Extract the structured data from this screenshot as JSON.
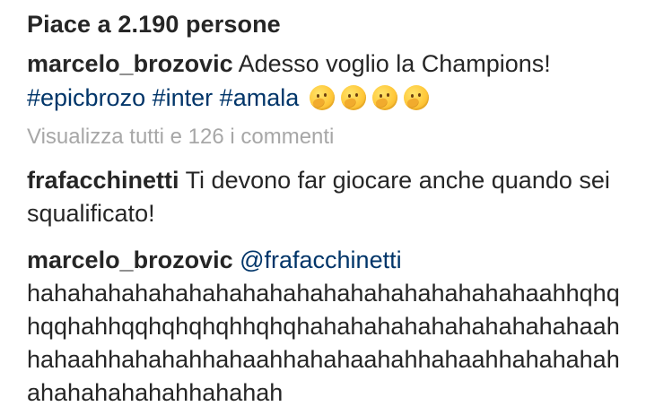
{
  "post": {
    "likes_text": "Piace a 2.190 persone",
    "caption_username": "marcelo_brozovic",
    "caption_text": "Adesso voglio la Champions!",
    "hashtags": [
      "#epicbrozo",
      "#inter",
      "#amala"
    ],
    "emojis": [
      "thinking-face-icon",
      "thinking-face-icon",
      "thinking-face-icon",
      "thinking-face-icon"
    ],
    "view_all_comments": "Visualizza tutti e 126 i commenti"
  },
  "comments": [
    {
      "username": "frafacchinetti",
      "text": "Ti devono far giocare anche quando sei squalificato!"
    },
    {
      "username": "marcelo_brozovic",
      "mention": "@frafacchinetti",
      "text": "hahahahahahahahahahahahahahahahahahahaahhqhqhqqhahhqqhqhqhqhhqhqhahahahahahahahahahahaahhahaahhahahahhahaahhahahaahahhahaahhahahahahahahahahahahhahahah"
    }
  ],
  "colors": {
    "text_primary": "#262626",
    "hashtag": "#003569",
    "muted": "#a7a7a7",
    "background": "#ffffff"
  }
}
